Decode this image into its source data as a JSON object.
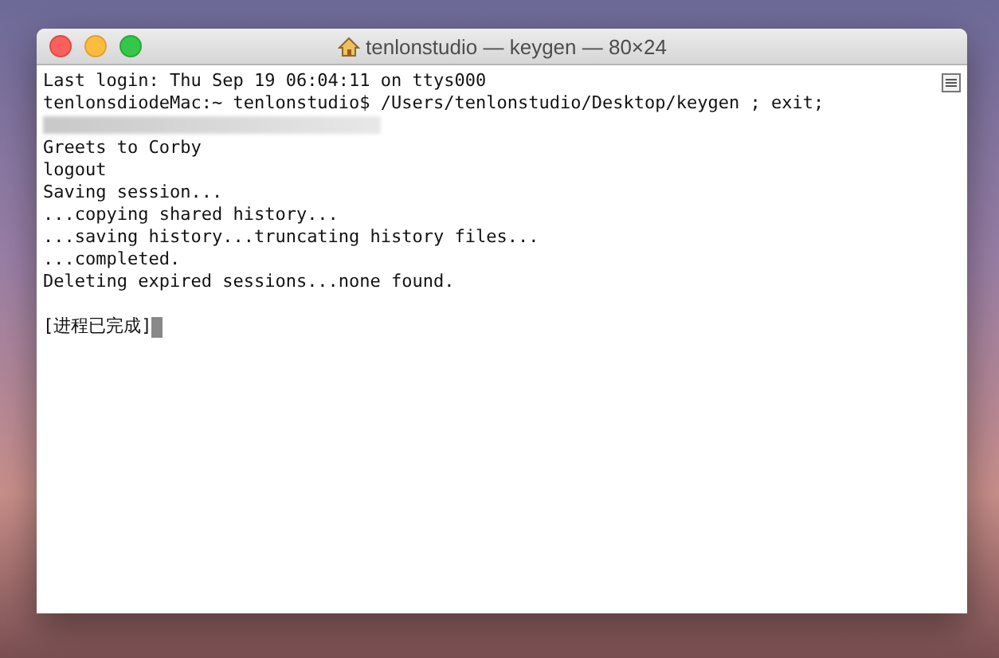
{
  "window": {
    "title": "tenlonstudio — keygen — 80×24"
  },
  "lines": [
    {
      "kind": "text",
      "text": "Last login: Thu Sep 19 06:04:11 on ttys000"
    },
    {
      "kind": "text",
      "text": "tenlonsdiodeMac:~ tenlonstudio$ /Users/tenlonstudio/Desktop/keygen ; exit;"
    },
    {
      "kind": "blurred"
    },
    {
      "kind": "text",
      "text": "Greets to Corby"
    },
    {
      "kind": "text",
      "text": "logout"
    },
    {
      "kind": "text",
      "text": "Saving session..."
    },
    {
      "kind": "text",
      "text": "...copying shared history..."
    },
    {
      "kind": "text",
      "text": "...saving history...truncating history files..."
    },
    {
      "kind": "text",
      "text": "...completed."
    },
    {
      "kind": "text",
      "text": "Deleting expired sessions...none found."
    },
    {
      "kind": "blank"
    },
    {
      "kind": "cursor",
      "text": "[进程已完成]"
    }
  ]
}
